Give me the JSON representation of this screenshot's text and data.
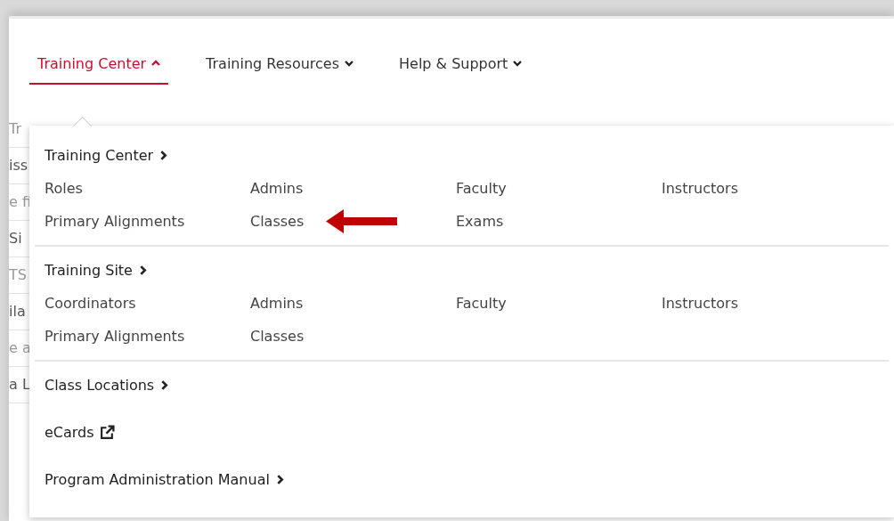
{
  "nav": [
    {
      "label": "Training Center",
      "selected": true,
      "expanded": true
    },
    {
      "label": "Training Resources",
      "selected": false,
      "expanded": false
    },
    {
      "label": "Help & Support",
      "selected": false,
      "expanded": false
    }
  ],
  "background_fragments": [
    "Tr",
    "iss",
    "e fi",
    "Si",
    "TS",
    "ila",
    "e a",
    "a L"
  ],
  "menu": {
    "sections": [
      {
        "heading": "Training Center",
        "kind": "chevron",
        "items": [
          {
            "label": "Roles"
          },
          {
            "label": "Admins"
          },
          {
            "label": "Faculty"
          },
          {
            "label": "Instructors"
          },
          {
            "label": "Primary Alignments"
          },
          {
            "label": "Classes",
            "arrow": true
          },
          {
            "label": "Exams"
          }
        ]
      },
      {
        "heading": "Training Site",
        "kind": "chevron",
        "items": [
          {
            "label": "Coordinators"
          },
          {
            "label": "Admins"
          },
          {
            "label": "Faculty"
          },
          {
            "label": "Instructors"
          },
          {
            "label": "Primary Alignments"
          },
          {
            "label": "Classes"
          }
        ]
      },
      {
        "heading": "Class Locations",
        "kind": "chevron"
      },
      {
        "heading": "eCards",
        "kind": "external"
      },
      {
        "heading": "Program Administration Manual",
        "kind": "chevron"
      }
    ]
  }
}
